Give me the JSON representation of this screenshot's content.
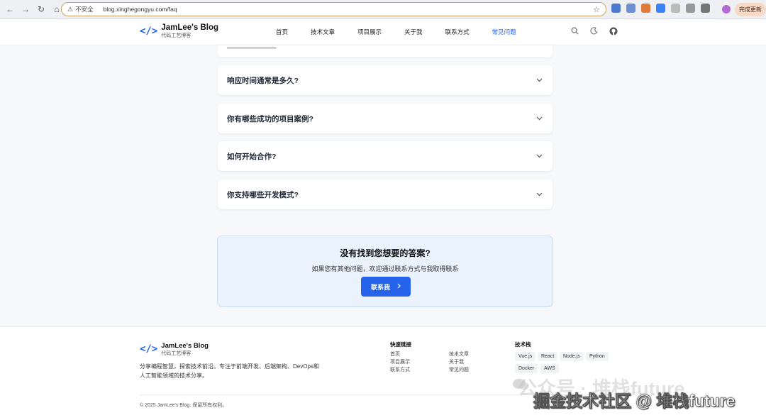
{
  "browser": {
    "security_label": "不安全",
    "url": "blog.xinghegongyu.com/faq",
    "update_label": "完成更新"
  },
  "site": {
    "brand_icon": "</>",
    "brand_name": "JamLee's Blog",
    "brand_sub": "代码工艺博客",
    "nav": [
      "首页",
      "技术文章",
      "项目展示",
      "关于我",
      "联系方式",
      "常见问题"
    ],
    "active_nav_index": 5
  },
  "faq": {
    "questions": [
      "响应时间通常是多久?",
      "你有哪些成功的项目案例?",
      "如何开始合作?",
      "你支持哪些开发模式?"
    ]
  },
  "cta": {
    "title": "没有找到您想要的答案?",
    "desc": "如果您有其他问题，欢迎通过联系方式与我取得联系",
    "button": "联系我"
  },
  "footer": {
    "brand_name": "JamLee's Blog",
    "brand_sub": "代码工艺博客",
    "desc": "分享编程智慧，探索技术前沿。专注于前端开发、后端架构、DevOps和人工智能领域的技术分享。",
    "quick_links_title": "快速链接",
    "quick_links": [
      "首页",
      "技术文章",
      "项目展示",
      "关于我",
      "联系方式",
      "常见问题"
    ],
    "tech_title": "技术栈",
    "tech_tags": [
      "Vue.js",
      "React",
      "Node.js",
      "Python",
      "Docker",
      "AWS"
    ],
    "copyright": "© 2025 JamLee's Blog. 保留所有权利。"
  },
  "watermark": {
    "line1": "公众号 · 堆栈future",
    "line2": "掘金技术社区 @ 堆栈future"
  },
  "colors": {
    "accent": "#2563eb",
    "cta_bg": "#eaf2fd"
  }
}
